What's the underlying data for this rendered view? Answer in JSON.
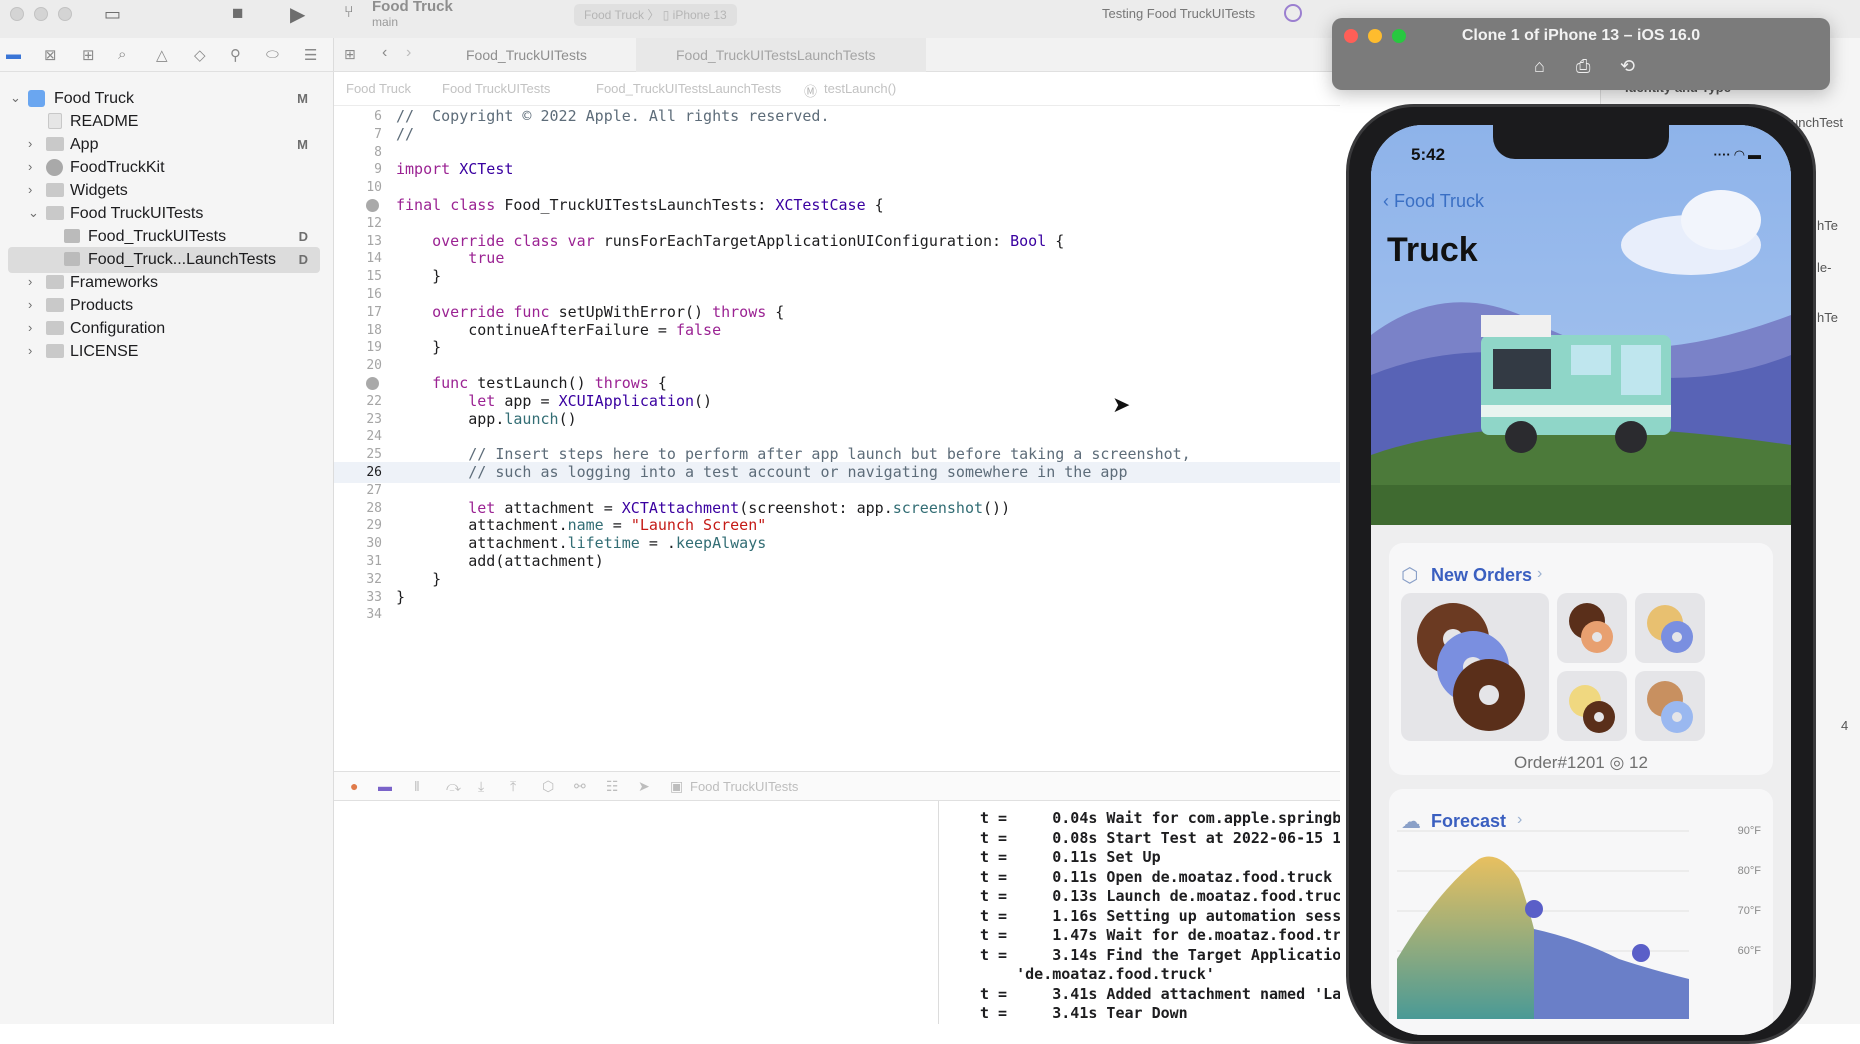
{
  "toolbar": {
    "scheme_title": "Food Truck",
    "scheme_branch": "main",
    "run_destination": "Food Truck",
    "run_device": "iPhone 13",
    "status": "Testing Food TruckUITests"
  },
  "navigator": {
    "items": [
      {
        "label": "Food Truck",
        "badge": "M",
        "kind": "proj"
      },
      {
        "label": "README",
        "badge": "",
        "kind": "doc"
      },
      {
        "label": "App",
        "badge": "M",
        "kind": "folder"
      },
      {
        "label": "FoodTruckKit",
        "badge": "",
        "kind": "pkg"
      },
      {
        "label": "Widgets",
        "badge": "",
        "kind": "folder"
      },
      {
        "label": "Food TruckUITests",
        "badge": "",
        "kind": "folder"
      },
      {
        "label": "Food_TruckUITests",
        "badge": "D",
        "kind": "swift"
      },
      {
        "label": "Food_Truck...LaunchTests",
        "badge": "D",
        "kind": "swift"
      },
      {
        "label": "Frameworks",
        "badge": "",
        "kind": "folder"
      },
      {
        "label": "Products",
        "badge": "",
        "kind": "folder"
      },
      {
        "label": "Configuration",
        "badge": "",
        "kind": "folder"
      },
      {
        "label": "LICENSE",
        "badge": "",
        "kind": "folder"
      }
    ]
  },
  "editor": {
    "tabs": [
      "Food_TruckUITests",
      "Food_TruckUITestsLaunchTests"
    ],
    "breadcrumb": [
      "Food Truck",
      "Food TruckUITests",
      "Food_TruckUITestsLaunchTests",
      "testLaunch()"
    ],
    "current_line": "26",
    "lines": [
      {
        "n": "6",
        "text": "//  Copyright © 2022 Apple. All rights reserved."
      },
      {
        "n": "7",
        "text": "//"
      },
      {
        "n": "8",
        "text": ""
      },
      {
        "n": "9",
        "text": "import XCTest"
      },
      {
        "n": "10",
        "text": ""
      },
      {
        "n": "11",
        "text": "final class Food_TruckUITestsLaunchTests: XCTestCase {"
      },
      {
        "n": "12",
        "text": ""
      },
      {
        "n": "13",
        "text": "    override class var runsForEachTargetApplicationUIConfiguration: Bool {"
      },
      {
        "n": "14",
        "text": "        true"
      },
      {
        "n": "15",
        "text": "    }"
      },
      {
        "n": "16",
        "text": ""
      },
      {
        "n": "17",
        "text": "    override func setUpWithError() throws {"
      },
      {
        "n": "18",
        "text": "        continueAfterFailure = false"
      },
      {
        "n": "19",
        "text": "    }"
      },
      {
        "n": "20",
        "text": ""
      },
      {
        "n": "21",
        "text": "    func testLaunch() throws {"
      },
      {
        "n": "22",
        "text": "        let app = XCUIApplication()"
      },
      {
        "n": "23",
        "text": "        app.launch()"
      },
      {
        "n": "24",
        "text": ""
      },
      {
        "n": "25",
        "text": "        // Insert steps here to perform after app launch but before taking a screenshot,"
      },
      {
        "n": "26",
        "text": "        // such as logging into a test account or navigating somewhere in the app"
      },
      {
        "n": "27",
        "text": ""
      },
      {
        "n": "28",
        "text": "        let attachment = XCTAttachment(screenshot: app.screenshot())"
      },
      {
        "n": "29",
        "text": "        attachment.name = \"Launch Screen\""
      },
      {
        "n": "30",
        "text": "        attachment.lifetime = .keepAlways"
      },
      {
        "n": "31",
        "text": "        add(attachment)"
      },
      {
        "n": "32",
        "text": "    }"
      },
      {
        "n": "33",
        "text": "}"
      },
      {
        "n": "34",
        "text": ""
      }
    ]
  },
  "debug": {
    "target_label": "Food TruckUITests",
    "log": [
      "t =     0.04s Wait for com.apple.springb",
      "t =     0.08s Start Test at 2022-06-15 1",
      "t =     0.11s Set Up",
      "t =     0.11s Open de.moataz.food.truck",
      "t =     0.13s Launch de.moataz.food.truc",
      "t =     1.16s Setting up automation sess",
      "t =     1.47s Wait for de.moataz.food.tr",
      "t =     3.14s Find the Target Applicatio",
      "    'de.moataz.food.truck'",
      "t =     3.41s Added attachment named 'La",
      "t =     3.41s Tear Down"
    ]
  },
  "inspector": {
    "heading": "Identity and Type",
    "field_1": "unchTest",
    "field_2": "hTe",
    "field_3": "le-",
    "field_4": "hTe",
    "stepper_value": "4"
  },
  "simulator": {
    "window_title": "Clone 1 of iPhone 13 – iOS 16.0",
    "status_time": "5:42",
    "back_label": "Food Truck",
    "nav_title": "Truck",
    "orders_title": "New Orders",
    "order_number": "Order#1201",
    "order_count": "12",
    "forecast_title": "Forecast",
    "forecast_axis": [
      "90°F",
      "80°F",
      "70°F",
      "60°F"
    ]
  },
  "colors": {
    "accent_blue": "#3a6fc4",
    "spinner_purple": "#9b7fd0",
    "sky": "#8fb4e8"
  }
}
